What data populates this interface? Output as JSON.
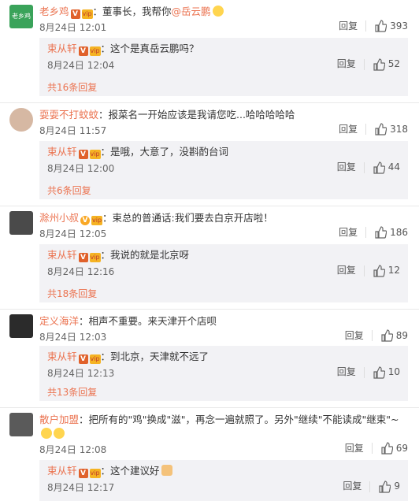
{
  "ui": {
    "reply_label": "回复",
    "badge_v": "V",
    "badge_crown": "vip"
  },
  "comments": [
    {
      "user": "老乡鸡",
      "avatar_text": "老乡鸡",
      "avatar_color": "#3aa35a",
      "text_prefix": "：董事长，我帮你",
      "mention": "@岳云鹏",
      "time": "8月24日 12:01",
      "likes": "393",
      "reply": {
        "user": "束从轩",
        "text": "：这个是真岳云鹏吗？",
        "time": "8月24日 12:04",
        "likes": "52"
      },
      "more": "共16条回复"
    },
    {
      "user": "耍耍不打蚊蚊",
      "avatar_color": "#d6b8a3",
      "text_prefix": "：报菜名一开始应该是我请您吃...哈哈哈哈哈",
      "time": "8月24日 11:57",
      "likes": "318",
      "reply": {
        "user": "束从轩",
        "text": "：是哦，大意了，没斟酌台词",
        "time": "8月24日 12:00",
        "likes": "44"
      },
      "more": "共6条回复"
    },
    {
      "user": "滁州小叔",
      "avatar_color": "#4a4a4a",
      "text_prefix": "：束总的普通话:我们要去白京开店啦！",
      "time": "8月24日 12:05",
      "likes": "186",
      "reply": {
        "user": "束从轩",
        "text": "：我说的就是北京呀",
        "time": "8月24日 12:16",
        "likes": "12"
      },
      "more": "共18条回复"
    },
    {
      "user": "定义海洋",
      "avatar_color": "#2b2b2b",
      "text_prefix": "：相声不重要。来天津开个店呗",
      "time": "8月24日 12:03",
      "likes": "89",
      "reply": {
        "user": "束从轩",
        "text": "：到北京，天津就不远了",
        "time": "8月24日 12:13",
        "likes": "10"
      },
      "more": "共13条回复"
    },
    {
      "user": "散户加盟",
      "avatar_color": "#5a5a5a",
      "text_prefix": "：把所有的\"鸡\"换成\"滋\"，再念一遍就照了。另外\"继续\"不能读成\"继束\"~",
      "time": "8月24日 12:08",
      "likes": "69",
      "reply": {
        "user": "束从轩",
        "text": "：这个建议好",
        "time": "8月24日 12:17",
        "likes": "9"
      }
    }
  ]
}
